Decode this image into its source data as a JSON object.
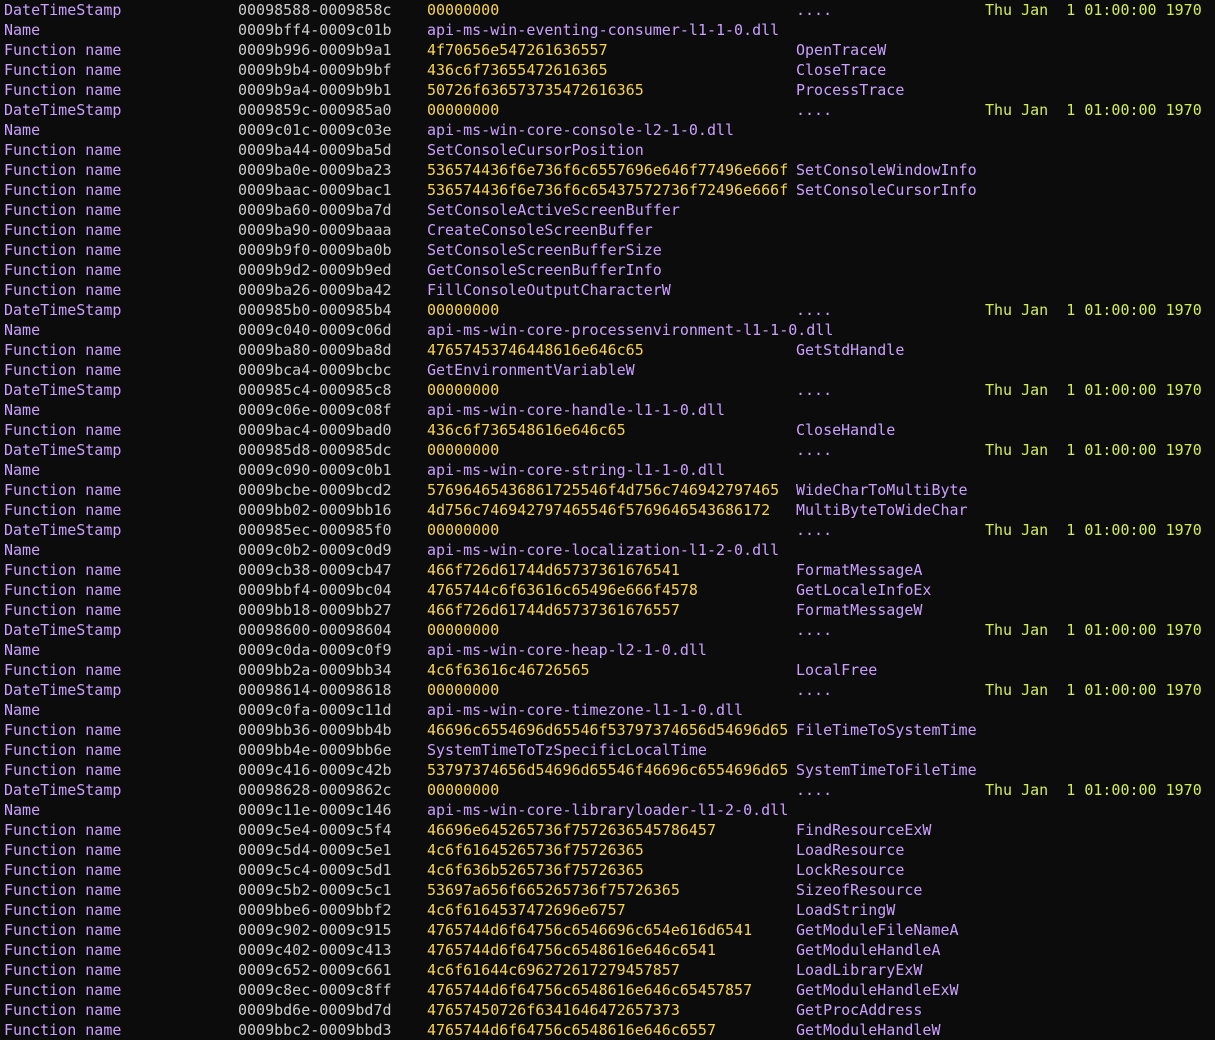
{
  "colors": {
    "background": "#0c0c0c",
    "type_label": "#c9a0ff",
    "address_range": "#cccccc",
    "hex_value": "#f9d448",
    "text_value": "#c9a0ff",
    "symbol": "#c9a0ff",
    "timestamp": "#d2ef4e"
  },
  "rows": [
    {
      "type": "DateTimeStamp",
      "range": "00098588-0009858c",
      "value": "00000000",
      "value_kind": "hex",
      "symbol": "....",
      "date": "Thu Jan  1 01:00:00 1970"
    },
    {
      "type": "Name",
      "range": "0009bff4-0009c01b",
      "value": "api-ms-win-eventing-consumer-l1-1-0.dll",
      "value_kind": "text",
      "symbol": "",
      "date": ""
    },
    {
      "type": "Function name",
      "range": "0009b996-0009b9a1",
      "value": "4f70656e547261636557",
      "value_kind": "hex",
      "symbol": "OpenTraceW",
      "date": ""
    },
    {
      "type": "Function name",
      "range": "0009b9b4-0009b9bf",
      "value": "436c6f73655472616365",
      "value_kind": "hex",
      "symbol": "CloseTrace",
      "date": ""
    },
    {
      "type": "Function name",
      "range": "0009b9a4-0009b9b1",
      "value": "50726f636573735472616365",
      "value_kind": "hex",
      "symbol": "ProcessTrace",
      "date": ""
    },
    {
      "type": "DateTimeStamp",
      "range": "0009859c-000985a0",
      "value": "00000000",
      "value_kind": "hex",
      "symbol": "....",
      "date": "Thu Jan  1 01:00:00 1970"
    },
    {
      "type": "Name",
      "range": "0009c01c-0009c03e",
      "value": "api-ms-win-core-console-l2-1-0.dll",
      "value_kind": "text",
      "symbol": "",
      "date": ""
    },
    {
      "type": "Function name",
      "range": "0009ba44-0009ba5d",
      "value": "SetConsoleCursorPosition",
      "value_kind": "text",
      "symbol": "",
      "date": ""
    },
    {
      "type": "Function name",
      "range": "0009ba0e-0009ba23",
      "value": "536574436f6e736f6c6557696e646f77496e666f",
      "value_kind": "hex",
      "symbol": "SetConsoleWindowInfo",
      "date": ""
    },
    {
      "type": "Function name",
      "range": "0009baac-0009bac1",
      "value": "536574436f6e736f6c65437572736f72496e666f",
      "value_kind": "hex",
      "symbol": "SetConsoleCursorInfo",
      "date": ""
    },
    {
      "type": "Function name",
      "range": "0009ba60-0009ba7d",
      "value": "SetConsoleActiveScreenBuffer",
      "value_kind": "text",
      "symbol": "",
      "date": ""
    },
    {
      "type": "Function name",
      "range": "0009ba90-0009baaa",
      "value": "CreateConsoleScreenBuffer",
      "value_kind": "text",
      "symbol": "",
      "date": ""
    },
    {
      "type": "Function name",
      "range": "0009b9f0-0009ba0b",
      "value": "SetConsoleScreenBufferSize",
      "value_kind": "text",
      "symbol": "",
      "date": ""
    },
    {
      "type": "Function name",
      "range": "0009b9d2-0009b9ed",
      "value": "GetConsoleScreenBufferInfo",
      "value_kind": "text",
      "symbol": "",
      "date": ""
    },
    {
      "type": "Function name",
      "range": "0009ba26-0009ba42",
      "value": "FillConsoleOutputCharacterW",
      "value_kind": "text",
      "symbol": "",
      "date": ""
    },
    {
      "type": "DateTimeStamp",
      "range": "000985b0-000985b4",
      "value": "00000000",
      "value_kind": "hex",
      "symbol": "....",
      "date": "Thu Jan  1 01:00:00 1970"
    },
    {
      "type": "Name",
      "range": "0009c040-0009c06d",
      "value": "api-ms-win-core-processenvironment-l1-1-0.dll",
      "value_kind": "text",
      "symbol": "",
      "date": ""
    },
    {
      "type": "Function name",
      "range": "0009ba80-0009ba8d",
      "value": "47657453746448616e646c65",
      "value_kind": "hex",
      "symbol": "GetStdHandle",
      "date": ""
    },
    {
      "type": "Function name",
      "range": "0009bca4-0009bcbc",
      "value": "GetEnvironmentVariableW",
      "value_kind": "text",
      "symbol": "",
      "date": ""
    },
    {
      "type": "DateTimeStamp",
      "range": "000985c4-000985c8",
      "value": "00000000",
      "value_kind": "hex",
      "symbol": "....",
      "date": "Thu Jan  1 01:00:00 1970"
    },
    {
      "type": "Name",
      "range": "0009c06e-0009c08f",
      "value": "api-ms-win-core-handle-l1-1-0.dll",
      "value_kind": "text",
      "symbol": "",
      "date": ""
    },
    {
      "type": "Function name",
      "range": "0009bac4-0009bad0",
      "value": "436c6f736548616e646c65",
      "value_kind": "hex",
      "symbol": "CloseHandle",
      "date": ""
    },
    {
      "type": "DateTimeStamp",
      "range": "000985d8-000985dc",
      "value": "00000000",
      "value_kind": "hex",
      "symbol": "....",
      "date": "Thu Jan  1 01:00:00 1970"
    },
    {
      "type": "Name",
      "range": "0009c090-0009c0b1",
      "value": "api-ms-win-core-string-l1-1-0.dll",
      "value_kind": "text",
      "symbol": "",
      "date": ""
    },
    {
      "type": "Function name",
      "range": "0009bcbe-0009bcd2",
      "value": "57696465436861725546f4d756c746942797465",
      "value_kind": "hex",
      "symbol": "WideCharToMultiByte",
      "date": ""
    },
    {
      "type": "Function name",
      "range": "0009bb02-0009bb16",
      "value": "4d756c746942797465546f5769646543686172",
      "value_kind": "hex",
      "symbol": "MultiByteToWideChar",
      "date": ""
    },
    {
      "type": "DateTimeStamp",
      "range": "000985ec-000985f0",
      "value": "00000000",
      "value_kind": "hex",
      "symbol": "....",
      "date": "Thu Jan  1 01:00:00 1970"
    },
    {
      "type": "Name",
      "range": "0009c0b2-0009c0d9",
      "value": "api-ms-win-core-localization-l1-2-0.dll",
      "value_kind": "text",
      "symbol": "",
      "date": ""
    },
    {
      "type": "Function name",
      "range": "0009cb38-0009cb47",
      "value": "466f726d61744d65737361676541",
      "value_kind": "hex",
      "symbol": "FormatMessageA",
      "date": ""
    },
    {
      "type": "Function name",
      "range": "0009bbf4-0009bc04",
      "value": "4765744c6f63616c65496e666f4578",
      "value_kind": "hex",
      "symbol": "GetLocaleInfoEx",
      "date": ""
    },
    {
      "type": "Function name",
      "range": "0009bb18-0009bb27",
      "value": "466f726d61744d65737361676557",
      "value_kind": "hex",
      "symbol": "FormatMessageW",
      "date": ""
    },
    {
      "type": "DateTimeStamp",
      "range": "00098600-00098604",
      "value": "00000000",
      "value_kind": "hex",
      "symbol": "....",
      "date": "Thu Jan  1 01:00:00 1970"
    },
    {
      "type": "Name",
      "range": "0009c0da-0009c0f9",
      "value": "api-ms-win-core-heap-l2-1-0.dll",
      "value_kind": "text",
      "symbol": "",
      "date": ""
    },
    {
      "type": "Function name",
      "range": "0009bb2a-0009bb34",
      "value": "4c6f63616c46726565",
      "value_kind": "hex",
      "symbol": "LocalFree",
      "date": ""
    },
    {
      "type": "DateTimeStamp",
      "range": "00098614-00098618",
      "value": "00000000",
      "value_kind": "hex",
      "symbol": "....",
      "date": "Thu Jan  1 01:00:00 1970"
    },
    {
      "type": "Name",
      "range": "0009c0fa-0009c11d",
      "value": "api-ms-win-core-timezone-l1-1-0.dll",
      "value_kind": "text",
      "symbol": "",
      "date": ""
    },
    {
      "type": "Function name",
      "range": "0009bb36-0009bb4b",
      "value": "46696c6554696d65546f53797374656d54696d65",
      "value_kind": "hex",
      "symbol": "FileTimeToSystemTime",
      "date": ""
    },
    {
      "type": "Function name",
      "range": "0009bb4e-0009bb6e",
      "value": "SystemTimeToTzSpecificLocalTime",
      "value_kind": "text",
      "symbol": "",
      "date": ""
    },
    {
      "type": "Function name",
      "range": "0009c416-0009c42b",
      "value": "53797374656d54696d65546f46696c6554696d65",
      "value_kind": "hex",
      "symbol": "SystemTimeToFileTime",
      "date": ""
    },
    {
      "type": "DateTimeStamp",
      "range": "00098628-0009862c",
      "value": "00000000",
      "value_kind": "hex",
      "symbol": "....",
      "date": "Thu Jan  1 01:00:00 1970"
    },
    {
      "type": "Name",
      "range": "0009c11e-0009c146",
      "value": "api-ms-win-core-libraryloader-l1-2-0.dll",
      "value_kind": "text",
      "symbol": "",
      "date": ""
    },
    {
      "type": "Function name",
      "range": "0009c5e4-0009c5f4",
      "value": "46696e645265736f7572636545786457",
      "value_kind": "hex",
      "symbol": "FindResourceExW",
      "date": ""
    },
    {
      "type": "Function name",
      "range": "0009c5d4-0009c5e1",
      "value": "4c6f61645265736f75726365",
      "value_kind": "hex",
      "symbol": "LoadResource",
      "date": ""
    },
    {
      "type": "Function name",
      "range": "0009c5c4-0009c5d1",
      "value": "4c6f636b5265736f75726365",
      "value_kind": "hex",
      "symbol": "LockResource",
      "date": ""
    },
    {
      "type": "Function name",
      "range": "0009c5b2-0009c5c1",
      "value": "53697a656f665265736f75726365",
      "value_kind": "hex",
      "symbol": "SizeofResource",
      "date": ""
    },
    {
      "type": "Function name",
      "range": "0009bbe6-0009bbf2",
      "value": "4c6f6164537472696e6757",
      "value_kind": "hex",
      "symbol": "LoadStringW",
      "date": ""
    },
    {
      "type": "Function name",
      "range": "0009c902-0009c915",
      "value": "4765744d6f64756c6546696c654e616d6541",
      "value_kind": "hex",
      "symbol": "GetModuleFileNameA",
      "date": ""
    },
    {
      "type": "Function name",
      "range": "0009c402-0009c413",
      "value": "4765744d6f64756c6548616e646c6541",
      "value_kind": "hex",
      "symbol": "GetModuleHandleA",
      "date": ""
    },
    {
      "type": "Function name",
      "range": "0009c652-0009c661",
      "value": "4c6f61644c696272617279457857",
      "value_kind": "hex",
      "symbol": "LoadLibraryExW",
      "date": ""
    },
    {
      "type": "Function name",
      "range": "0009c8ec-0009c8ff",
      "value": "4765744d6f64756c6548616e646c65457857",
      "value_kind": "hex",
      "symbol": "GetModuleHandleExW",
      "date": ""
    },
    {
      "type": "Function name",
      "range": "0009bd6e-0009bd7d",
      "value": "47657450726f6341646472657373",
      "value_kind": "hex",
      "symbol": "GetProcAddress",
      "date": ""
    },
    {
      "type": "Function name",
      "range": "0009bbc2-0009bbd3",
      "value": "4765744d6f64756c6548616e646c6557",
      "value_kind": "hex",
      "symbol": "GetModuleHandleW",
      "date": ""
    }
  ]
}
